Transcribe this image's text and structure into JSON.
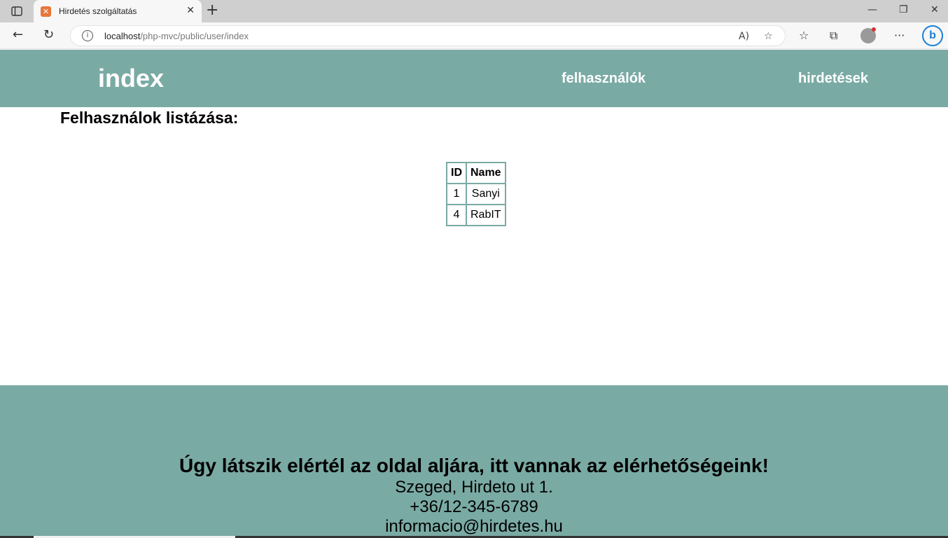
{
  "browser": {
    "tab_title": "Hirdetés szolgáltatás",
    "url_host": "localhost",
    "url_path": "/php-mvc/public/user/index",
    "icons": [
      "tab-actions-icon",
      "favicon-icon",
      "close-icon",
      "new-tab-icon",
      "minimize-icon",
      "restore-icon",
      "window-close-icon",
      "back-icon",
      "refresh-icon",
      "info-icon",
      "read-aloud-icon",
      "add-favorite-icon",
      "favorites-icon",
      "collections-icon",
      "profile-icon",
      "more-icon",
      "bing-icon"
    ],
    "accent_color": "#1b7fd4"
  },
  "header": {
    "title": "index",
    "nav": [
      "felhasználók",
      "hirdetések"
    ],
    "background_color": "#7aaaa4"
  },
  "main": {
    "heading": "Felhasználok listázása:",
    "table": {
      "columns": [
        "ID",
        "Name"
      ],
      "rows": [
        [
          "1",
          "Sanyi"
        ],
        [
          "4",
          "RabIT"
        ]
      ]
    }
  },
  "footer": {
    "title": "Úgy látszik elértél az oldal aljára, itt vannak az elérhetőségeink!",
    "address": "Szeged, Hirdeto ut 1.",
    "phone": "+36/12-345-6789",
    "email": "informacio@hirdetes.hu"
  }
}
